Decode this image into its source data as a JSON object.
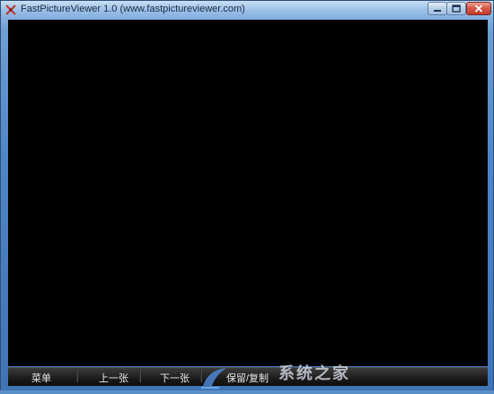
{
  "window": {
    "title": "FastPictureViewer 1.0 (www.fastpictureviewer.com)",
    "icons": {
      "app": "app-logo-icon",
      "minimize": "minimize-icon",
      "maximize": "maximize-icon",
      "close": "close-icon"
    }
  },
  "toolbar": {
    "menu_label": "菜单",
    "prev_label": "上一张",
    "next_label": "下一张",
    "copy_label": "保留/复制"
  },
  "watermark": {
    "text": "系统之家"
  },
  "colors": {
    "title_bar": "#9bc0e8",
    "client_background": "#000000",
    "bottom_bar": "#1b1b1b",
    "close_button": "#c23a2b"
  }
}
